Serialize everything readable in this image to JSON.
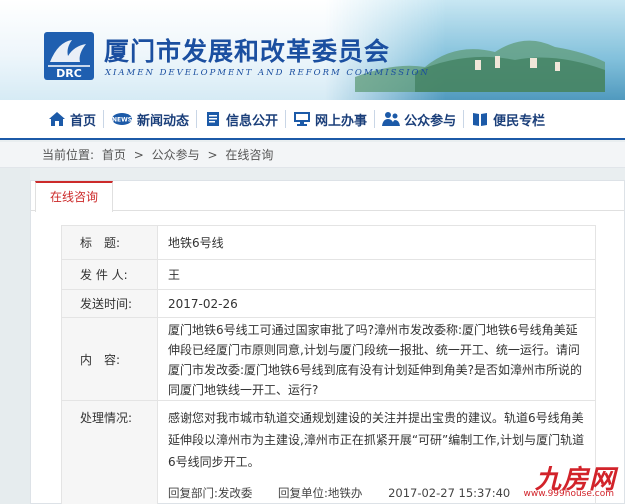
{
  "header": {
    "title_cn": "厦门市发展和改革委员会",
    "title_en": "XIAMEN DEVELOPMENT AND REFORM COMMISSION",
    "logo_text": "DRC"
  },
  "nav": {
    "items": [
      {
        "label": "首页",
        "icon": "home-icon"
      },
      {
        "label": "新闻动态",
        "icon": "news-icon"
      },
      {
        "label": "信息公开",
        "icon": "document-icon"
      },
      {
        "label": "网上办事",
        "icon": "computer-icon"
      },
      {
        "label": "公众参与",
        "icon": "people-icon"
      },
      {
        "label": "便民专栏",
        "icon": "book-icon"
      }
    ]
  },
  "breadcrumb": {
    "prefix": "当前位置:",
    "items": [
      "首页",
      "公众参与",
      "在线咨询"
    ],
    "separator": ">"
  },
  "tab": {
    "label": "在线咨询"
  },
  "record": {
    "title_label": "标　题:",
    "title_value": "地铁6号线",
    "sender_label": "发 件 人:",
    "sender_value": "王",
    "time_label": "发送时间:",
    "time_value": "2017-02-26",
    "content_label": "内　容:",
    "content_value": "厦门地铁6号线工可通过国家审批了吗?漳州市发改委称:厦门地铁6号线角美延伸段已经厦门市原则同意,计划与厦门段统一报批、统一开工、统一运行。请问厦门市发改委:厦门地铁6号线到底有没有计划延伸到角美?是否如漳州市所说的同厦门地铁线一开工、运行?",
    "reply_label": "处理情况:",
    "reply_value": "感谢您对我市城市轨道交通规划建设的关注并提出宝贵的建议。轨道6号线角美延伸段以漳州市为主建设,漳州市正在抓紧开展“可研”编制工作,计划与厦门轨道6号线同步开工。",
    "reply_dept": "回复部门:发改委",
    "reply_unit": "回复单位:地铁办",
    "reply_time": "2017-02-27 15:37:40"
  },
  "watermark": {
    "brand": "九房网",
    "url": "www.999house.com"
  },
  "colors": {
    "brand_blue": "#1b4fa0",
    "accent_red": "#cc2a2a"
  }
}
